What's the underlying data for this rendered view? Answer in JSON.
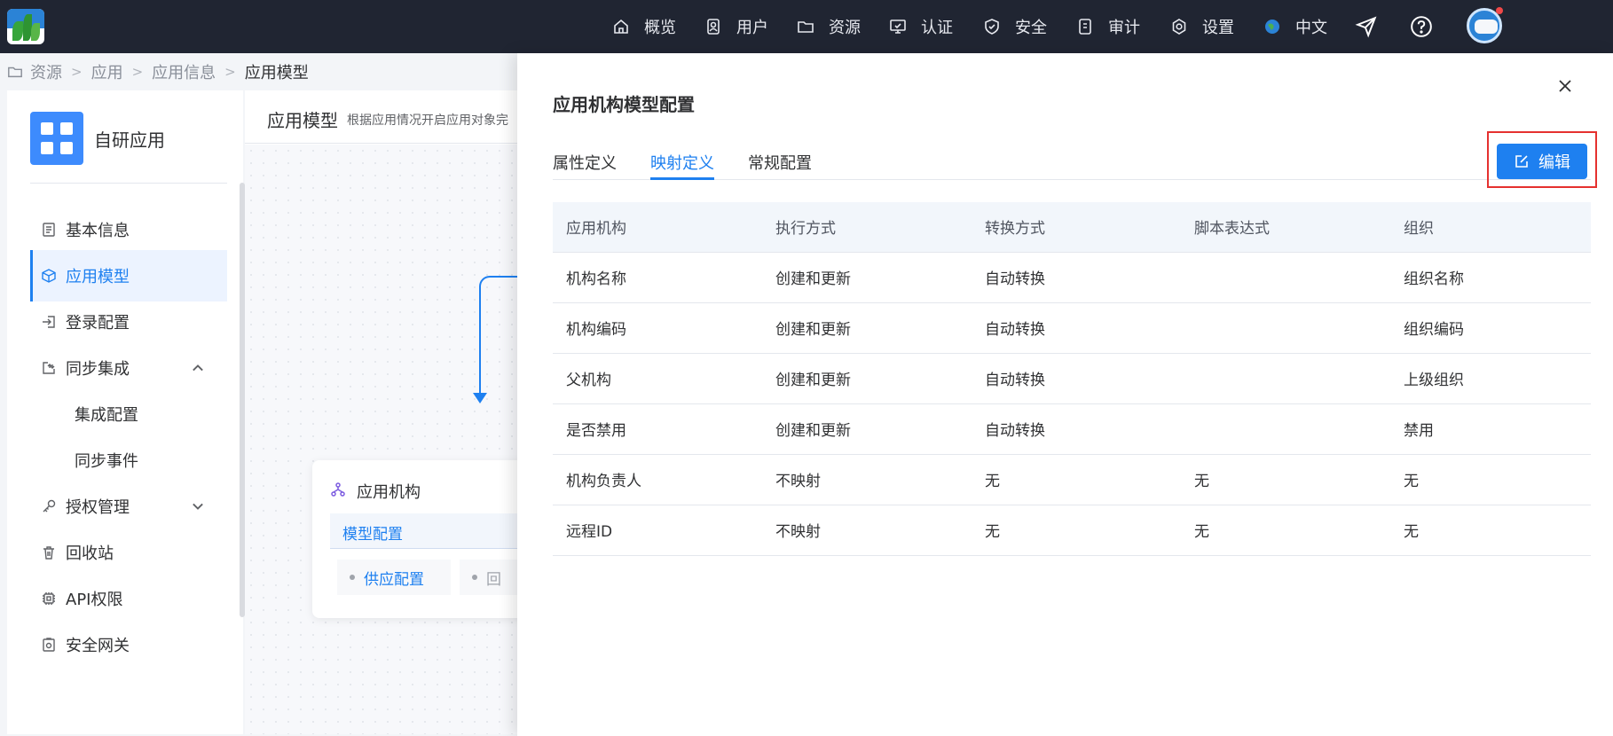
{
  "topbar": {
    "nav": [
      {
        "label": "概览",
        "icon": "home-icon"
      },
      {
        "label": "用户",
        "icon": "user-icon"
      },
      {
        "label": "资源",
        "icon": "folder-icon"
      },
      {
        "label": "认证",
        "icon": "monitor-icon"
      },
      {
        "label": "安全",
        "icon": "shield-icon"
      },
      {
        "label": "审计",
        "icon": "audit-icon"
      },
      {
        "label": "设置",
        "icon": "gear-icon"
      },
      {
        "label": "中文",
        "icon": "globe-icon"
      }
    ],
    "extra_icons": [
      "send-icon",
      "help-icon",
      "avatar"
    ]
  },
  "breadcrumb": [
    "资源",
    "应用",
    "应用信息",
    "应用模型"
  ],
  "left": {
    "app_name": "自研应用",
    "menu": [
      {
        "label": "基本信息",
        "icon": "info-doc-icon",
        "active": false
      },
      {
        "label": "应用模型",
        "icon": "cube-icon",
        "active": true
      },
      {
        "label": "登录配置",
        "icon": "login-icon",
        "active": false
      },
      {
        "label": "同步集成",
        "icon": "sync-icon",
        "active": false,
        "expanded": true
      },
      {
        "label": "集成配置",
        "icon": "",
        "active": false,
        "sub": true
      },
      {
        "label": "同步事件",
        "icon": "",
        "active": false,
        "sub": true
      },
      {
        "label": "授权管理",
        "icon": "key-icon",
        "active": false,
        "expanded": false
      },
      {
        "label": "回收站",
        "icon": "trash-icon",
        "active": false
      },
      {
        "label": "API权限",
        "icon": "chip-icon",
        "active": false
      },
      {
        "label": "安全网关",
        "icon": "gateway-icon",
        "active": false
      }
    ]
  },
  "main": {
    "title": "应用模型",
    "subtitle": "根据应用情况开启应用对象完",
    "node": {
      "title": "应用机构",
      "tab": "模型配置",
      "chips": [
        "供应配置",
        "回"
      ]
    }
  },
  "drawer": {
    "title": "应用机构模型配置",
    "tabs": [
      "属性定义",
      "映射定义",
      "常规配置"
    ],
    "active_tab": "映射定义",
    "edit_label": "编辑",
    "table": {
      "columns": [
        "应用机构",
        "执行方式",
        "转换方式",
        "脚本表达式",
        "组织"
      ],
      "rows": [
        [
          "机构名称",
          "创建和更新",
          "自动转换",
          "",
          "组织名称"
        ],
        [
          "机构编码",
          "创建和更新",
          "自动转换",
          "",
          "组织编码"
        ],
        [
          "父机构",
          "创建和更新",
          "自动转换",
          "",
          "上级组织"
        ],
        [
          "是否禁用",
          "创建和更新",
          "自动转换",
          "",
          "禁用"
        ],
        [
          "机构负责人",
          "不映射",
          "无",
          "无",
          "无"
        ],
        [
          "远程ID",
          "不映射",
          "无",
          "无",
          "无"
        ]
      ]
    }
  },
  "colors": {
    "accent": "#1e80f0",
    "topbar": "#202532",
    "highlight_outline": "#e5312f"
  }
}
